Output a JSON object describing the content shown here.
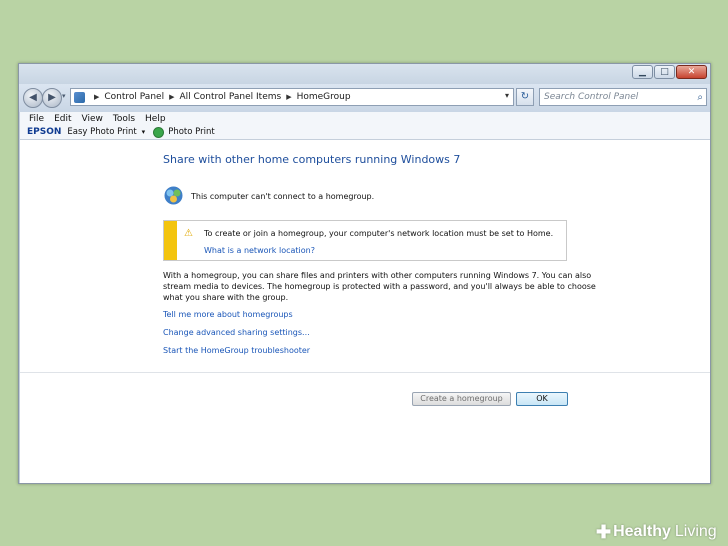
{
  "window": {
    "caption_buttons": {
      "minimize": "▁",
      "maximize": "□",
      "close": "✕"
    }
  },
  "nav": {
    "back_icon": "◀",
    "forward_icon": "▶",
    "dropdown_icon": "▾"
  },
  "address": {
    "crumbs": [
      "Control Panel",
      "All Control Panel Items",
      "HomeGroup"
    ],
    "separator": "▶",
    "dropdown_icon": "▾",
    "refresh_icon": "↻"
  },
  "search": {
    "placeholder": "Search Control Panel",
    "icon": "⌕"
  },
  "menu": [
    "File",
    "Edit",
    "View",
    "Tools",
    "Help"
  ],
  "epson_toolbar": {
    "logo": "EPSON",
    "app": "Easy Photo Print",
    "dropdown_icon": "▾",
    "photo_print": "Photo Print"
  },
  "main": {
    "heading": "Share with other home computers running Windows 7",
    "status": "This computer can't connect to a homegroup.",
    "warning": {
      "icon": "⚠",
      "text": "To create or join a homegroup, your computer's network location must be set to Home.",
      "link": "What is a network location?"
    },
    "paragraph_lines": [
      "With a homegroup, you can share files and printers with other computers running Windows 7. You can also",
      "stream media to devices. The homegroup is protected with a password, and you'll always be able to choose",
      "what you share with the group."
    ],
    "links": [
      "Tell me more about homegroups",
      "Change advanced sharing settings...",
      "Start the HomeGroup troubleshooter"
    ]
  },
  "buttons": {
    "create": "Create a homegroup",
    "ok": "OK"
  },
  "watermark": {
    "cross": "✚",
    "brand1": "Healthy",
    "brand2": "Living"
  }
}
